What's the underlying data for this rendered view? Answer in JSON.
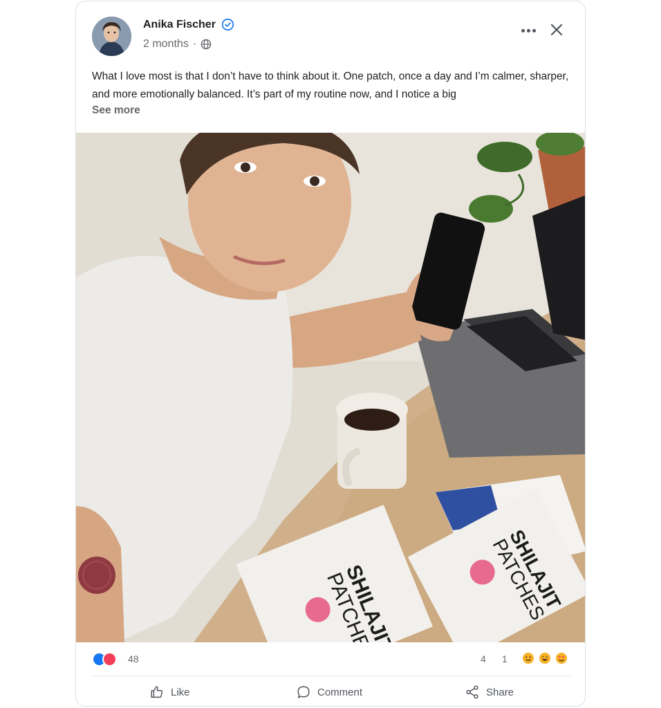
{
  "post": {
    "author": {
      "name": "Anika Fischer",
      "verified": true,
      "avatar": "avatar"
    },
    "meta": {
      "time": "2 months",
      "separator": "·",
      "privacy_icon": "globe-icon"
    },
    "text": "What I love most is that I don’t have to think about it. One patch, once a day and I’m calmer, sharper, and more emotionally balanced. It’s part of my routine now, and I notice a big",
    "see_more": "See more",
    "photo": {
      "box_label": "SHILAJIT PATCHES",
      "box_label_1": "SHILAJIT",
      "box_label_2": "PATCHES"
    }
  },
  "header_actions": {
    "more_icon": "more-horizontal-icon",
    "close_icon": "close-icon"
  },
  "engagement": {
    "reaction_count": "48",
    "comments": "4",
    "shares": "1",
    "reaction_types": [
      "like-reaction",
      "love-reaction"
    ],
    "emoji_icons": [
      "smile-emoji-icon",
      "laugh-emoji-icon",
      "heart-eyes-emoji-icon"
    ]
  },
  "actions": {
    "like": "Like",
    "comment": "Comment",
    "share": "Share"
  },
  "colors": {
    "verified": "#1877f2",
    "like": "#1877f2",
    "love": "#f33e58",
    "emoji_yellow": "#f7b125"
  }
}
